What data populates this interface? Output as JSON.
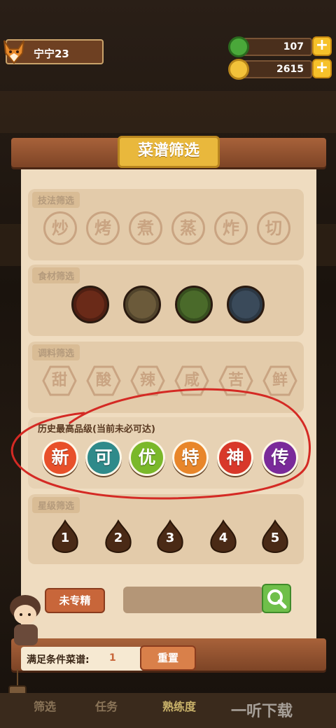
{
  "user": {
    "name": "宁宁23"
  },
  "resources": {
    "gems": "107",
    "coins": "2615",
    "plus": "+"
  },
  "panel": {
    "title": "菜谱筛选"
  },
  "technique": {
    "label": "技法筛选",
    "items": [
      "炒",
      "烤",
      "煮",
      "蒸",
      "炸",
      "切"
    ]
  },
  "ingredients": {
    "label": "食材筛选",
    "colors": [
      "#6a2a18",
      "#6b5a3a",
      "#4a6a2a",
      "#3a4a5a"
    ]
  },
  "seasoning": {
    "label": "调料筛选",
    "items": [
      "甜",
      "酸",
      "辣",
      "咸",
      "苦",
      "鲜"
    ]
  },
  "grade": {
    "label": "历史最高品级(当前未必可达)",
    "items": [
      {
        "label": "新",
        "color": "#e8502a"
      },
      {
        "label": "可",
        "color": "#2f8a8a"
      },
      {
        "label": "优",
        "color": "#7ab82a"
      },
      {
        "label": "特",
        "color": "#e8862a"
      },
      {
        "label": "神",
        "color": "#d8382a"
      },
      {
        "label": "传",
        "color": "#7a2a9a"
      }
    ]
  },
  "stars": {
    "label": "星级筛选",
    "items": [
      "1",
      "2",
      "3",
      "4",
      "5"
    ]
  },
  "controls": {
    "unmastered": "未专精",
    "reset": "重置"
  },
  "result": {
    "label": "满足条件菜谱:",
    "count": "1"
  },
  "bottom_tabs": [
    "筛选",
    "任务",
    "熟练度"
  ],
  "watermark": "一听下载"
}
